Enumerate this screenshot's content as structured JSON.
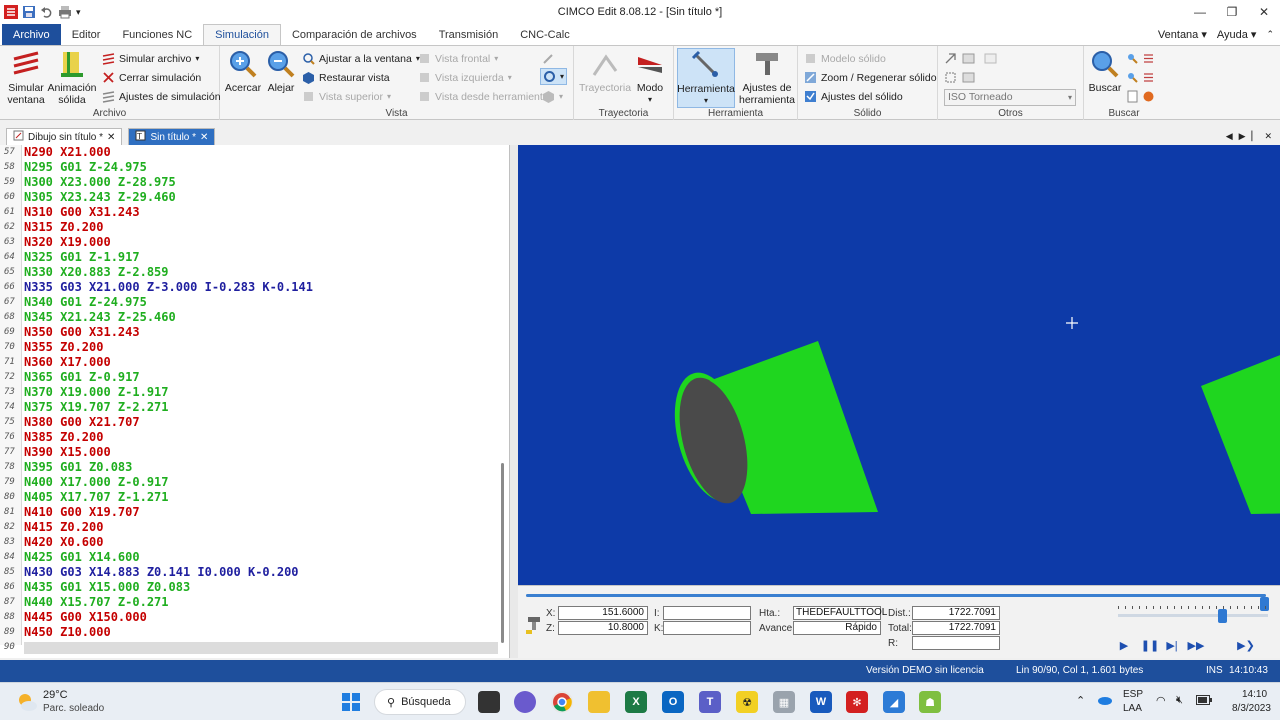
{
  "app": {
    "title": "CIMCO Edit 8.08.12 - [Sin título *]"
  },
  "window": {
    "minimize": "—",
    "restore": "❐",
    "close": "✕"
  },
  "ribbon_tabs": [
    {
      "label": "Archivo"
    },
    {
      "label": "Editor"
    },
    {
      "label": "Funciones NC"
    },
    {
      "label": "Simulación"
    },
    {
      "label": "Comparación de archivos"
    },
    {
      "label": "Transmisión"
    },
    {
      "label": "CNC-Calc"
    }
  ],
  "ribbon_right": {
    "ventana": "Ventana ▾",
    "ayuda": "Ayuda ▾"
  },
  "ribbon": {
    "archivo": {
      "label": "Archivo",
      "simular_ventana": "Simular ventana",
      "animacion_solida": "Animación sólida",
      "simular_archivo": "Simular archivo",
      "cerrar_simulacion": "Cerrar simulación",
      "ajustes_simulacion": "Ajustes de simulación"
    },
    "vista": {
      "label": "Vista",
      "acercar": "Acercar",
      "alejar": "Alejar",
      "ajustar_ventana": "Ajustar a la ventana",
      "restaurar_vista": "Restaurar vista",
      "vista_superior": "Vista superior",
      "vista_frontal": "Vista frontal",
      "vista_izquierda": "Vista izquierda",
      "vista_herramienta": "Vista desde herramienta"
    },
    "trayectoria": {
      "label": "Trayectoria",
      "trayectoria": "Trayectoria",
      "modo": "Modo"
    },
    "herramienta": {
      "label": "Herramienta",
      "herramienta": "Herramienta",
      "ajustes_herramienta": "Ajustes de herramienta"
    },
    "solido": {
      "label": "Sólido",
      "modelo_solido": "Modelo sólido",
      "zoom_regenerar": "Zoom / Regenerar sólido",
      "ajustes_solido": "Ajustes del sólido"
    },
    "otros": {
      "label": "Otros",
      "combo": "ISO Torneado"
    },
    "buscar": {
      "label": "Buscar",
      "buscar": "Buscar"
    }
  },
  "doc_tabs": [
    {
      "label": "Dibujo sin título *"
    },
    {
      "label": "Sin título *"
    }
  ],
  "editor": {
    "lines": [
      {
        "n": "57",
        "text": "N290 X21.000",
        "color": "red"
      },
      {
        "n": "58",
        "text": "N295 G01 Z-24.975",
        "color": "green"
      },
      {
        "n": "59",
        "text": "N300 X23.000 Z-28.975",
        "color": "green"
      },
      {
        "n": "60",
        "text": "N305 X23.243 Z-29.460",
        "color": "green"
      },
      {
        "n": "61",
        "text": "N310 G00 X31.243",
        "color": "red"
      },
      {
        "n": "62",
        "text": "N315 Z0.200",
        "color": "red"
      },
      {
        "n": "63",
        "text": "N320 X19.000",
        "color": "red"
      },
      {
        "n": "64",
        "text": "N325 G01 Z-1.917",
        "color": "green"
      },
      {
        "n": "65",
        "text": "N330 X20.883 Z-2.859",
        "color": "green"
      },
      {
        "n": "66",
        "text": "N335 G03 X21.000 Z-3.000 I-0.283 K-0.141",
        "color": "blue"
      },
      {
        "n": "67",
        "text": "N340 G01 Z-24.975",
        "color": "green"
      },
      {
        "n": "68",
        "text": "N345 X21.243 Z-25.460",
        "color": "green"
      },
      {
        "n": "69",
        "text": "N350 G00 X31.243",
        "color": "red"
      },
      {
        "n": "70",
        "text": "N355 Z0.200",
        "color": "red"
      },
      {
        "n": "71",
        "text": "N360 X17.000",
        "color": "red"
      },
      {
        "n": "72",
        "text": "N365 G01 Z-0.917",
        "color": "green"
      },
      {
        "n": "73",
        "text": "N370 X19.000 Z-1.917",
        "color": "green"
      },
      {
        "n": "74",
        "text": "N375 X19.707 Z-2.271",
        "color": "green"
      },
      {
        "n": "75",
        "text": "N380 G00 X21.707",
        "color": "red"
      },
      {
        "n": "76",
        "text": "N385 Z0.200",
        "color": "red"
      },
      {
        "n": "77",
        "text": "N390 X15.000",
        "color": "red"
      },
      {
        "n": "78",
        "text": "N395 G01 Z0.083",
        "color": "green"
      },
      {
        "n": "79",
        "text": "N400 X17.000 Z-0.917",
        "color": "green"
      },
      {
        "n": "80",
        "text": "N405 X17.707 Z-1.271",
        "color": "green"
      },
      {
        "n": "81",
        "text": "N410 G00 X19.707",
        "color": "red"
      },
      {
        "n": "82",
        "text": "N415 Z0.200",
        "color": "red"
      },
      {
        "n": "83",
        "text": "N420 X0.600",
        "color": "red"
      },
      {
        "n": "84",
        "text": "N425 G01 X14.600",
        "color": "green"
      },
      {
        "n": "85",
        "text": "N430 G03 X14.883 Z0.141 I0.000 K-0.200",
        "color": "blue"
      },
      {
        "n": "86",
        "text": "N435 G01 X15.000 Z0.083",
        "color": "green"
      },
      {
        "n": "87",
        "text": "N440 X15.707 Z-0.271",
        "color": "green"
      },
      {
        "n": "88",
        "text": "N445 G00 X150.000",
        "color": "red"
      },
      {
        "n": "89",
        "text": "N450 Z10.000",
        "color": "red"
      },
      {
        "n": "90",
        "text": "",
        "color": "red"
      }
    ]
  },
  "sim": {
    "x_label": "X:",
    "x_value": "151.6000",
    "z_label": "Z:",
    "z_value": "10.8000",
    "i_label": "I:",
    "i_value": "",
    "k_label": "K:",
    "k_value": "",
    "hta_label": "Hta.:",
    "hta_value": "THEDEFAULTTOOL",
    "avance_label": "Avance:",
    "avance_value": "Rápido",
    "dist_label": "Dist.:",
    "dist_value": "1722.7091",
    "total_label": "Total:",
    "total_value": "1722.7091",
    "r_label": "R:",
    "r_value": "",
    "progress": 1.0,
    "speed": 0.5
  },
  "status": {
    "version": "Versión DEMO sin licencia",
    "position": "Lin 90/90, Col 1, 1.601 bytes",
    "mode": "INS",
    "time": "14:10:43"
  },
  "taskbar": {
    "weather_temp": "29°C",
    "weather_desc": "Parc. soleado",
    "search": "Búsqueda",
    "lang1": "ESP",
    "lang2": "LAA",
    "clock_time": "14:10",
    "clock_date": "8/3/2023"
  },
  "colors": {
    "accent": "#1e4f9c",
    "viewport_bg": "#0d3aa8",
    "part_green": "#1fd61f",
    "code_red": "#c40000",
    "code_green": "#1fae1f",
    "code_blue": "#1f1f9f"
  }
}
